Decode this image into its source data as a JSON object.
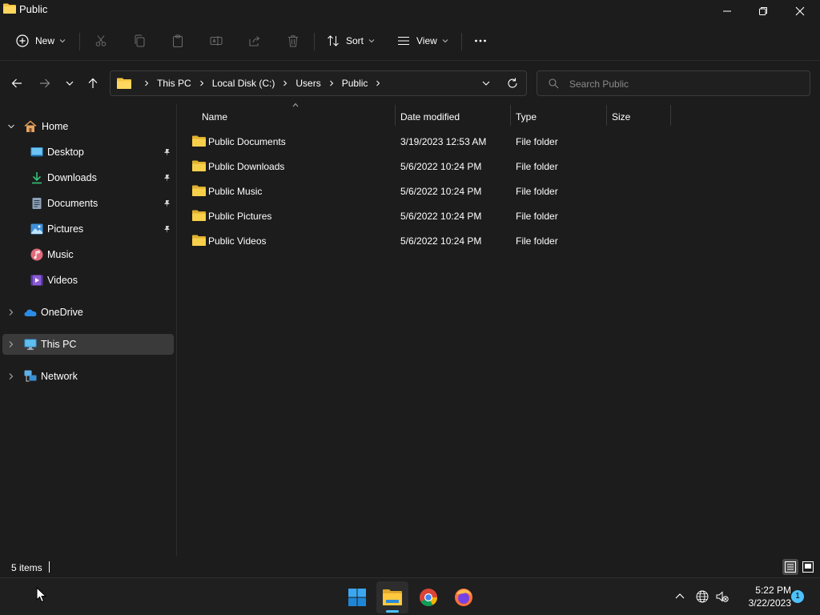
{
  "window": {
    "title": "Public",
    "icons": {
      "app": "folder-icon",
      "minimize": "minimize-icon",
      "maximize": "restore-icon",
      "close": "close-icon"
    }
  },
  "commandbar": {
    "new_label": "New",
    "sort_label": "Sort",
    "view_label": "View",
    "icons": [
      "plus-circle-icon",
      "cut-icon",
      "copy-icon",
      "paste-icon",
      "rename-icon",
      "share-icon",
      "delete-icon",
      "sort-icon",
      "view-icon",
      "more-icon"
    ]
  },
  "navigation": {
    "icons": [
      "back-arrow-icon",
      "forward-arrow-icon",
      "recent-chevron-icon",
      "up-arrow-icon"
    ]
  },
  "address": {
    "breadcrumbs": [
      "This PC",
      "Local Disk (C:)",
      "Users",
      "Public"
    ]
  },
  "search": {
    "placeholder": "Search Public"
  },
  "sidebar": {
    "items": [
      {
        "label": "Home",
        "icon": "home-icon"
      },
      {
        "label": "Desktop",
        "icon": "desktop-icon",
        "pinned": true
      },
      {
        "label": "Downloads",
        "icon": "download-icon",
        "pinned": true
      },
      {
        "label": "Documents",
        "icon": "document-icon",
        "pinned": true
      },
      {
        "label": "Pictures",
        "icon": "pictures-icon",
        "pinned": true
      },
      {
        "label": "Music",
        "icon": "music-icon"
      },
      {
        "label": "Videos",
        "icon": "videos-icon"
      },
      {
        "label": "OneDrive",
        "icon": "cloud-icon"
      },
      {
        "label": "This PC",
        "icon": "monitor-icon",
        "selected": true
      },
      {
        "label": "Network",
        "icon": "network-icon"
      }
    ]
  },
  "table": {
    "columns": [
      "Name",
      "Date modified",
      "Type",
      "Size"
    ],
    "rows": [
      {
        "name": "Public Documents",
        "date": "3/19/2023 12:53 AM",
        "type": "File folder",
        "size": ""
      },
      {
        "name": "Public Downloads",
        "date": "5/6/2022 10:24 PM",
        "type": "File folder",
        "size": ""
      },
      {
        "name": "Public Music",
        "date": "5/6/2022 10:24 PM",
        "type": "File folder",
        "size": ""
      },
      {
        "name": "Public Pictures",
        "date": "5/6/2022 10:24 PM",
        "type": "File folder",
        "size": ""
      },
      {
        "name": "Public Videos",
        "date": "5/6/2022 10:24 PM",
        "type": "File folder",
        "size": ""
      }
    ]
  },
  "status": {
    "item_count": "5 items",
    "view_icons": [
      "details-view-icon",
      "large-icons-view-icon"
    ]
  },
  "taskbar": {
    "apps": [
      "windows-start-icon",
      "file-explorer-icon",
      "chrome-icon",
      "firefox-icon"
    ],
    "tray_icons": [
      "chevron-up-icon",
      "network-globe-icon",
      "volume-muted-icon"
    ],
    "time": "5:22 PM",
    "date": "3/22/2023",
    "notification_count": "1"
  },
  "colors": {
    "background": "#1c1c1c",
    "folder_yellow": "#f4c542",
    "accent": "#4cc2ff",
    "selected_bg": "#3a3a3a"
  }
}
